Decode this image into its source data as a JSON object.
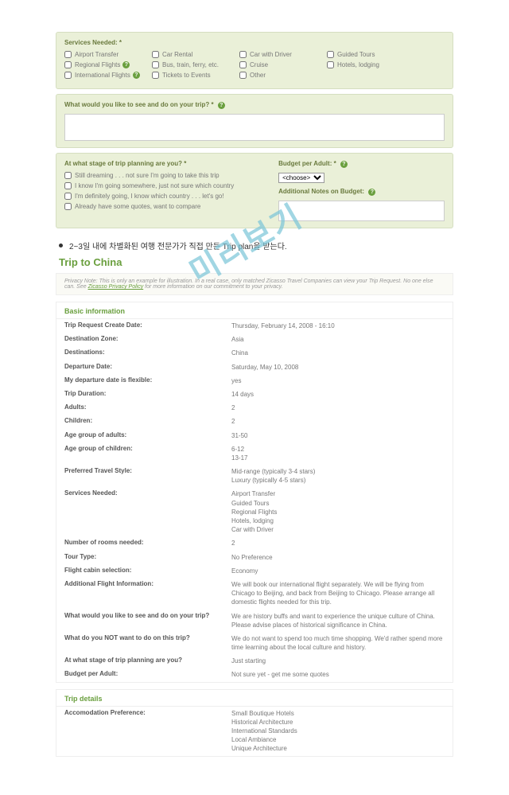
{
  "watermark": "미리보기",
  "services": {
    "label": "Services Needed: *",
    "items": [
      "Airport Transfer",
      "Car Rental",
      "Car with Driver",
      "Guided Tours",
      "Regional Flights",
      "Bus, train, ferry, etc.",
      "Cruise",
      "Hotels, lodging",
      "International Flights",
      "Tickets to Events",
      "Other"
    ]
  },
  "see_do": {
    "label": "What would you like to see and do on your trip? *"
  },
  "stage": {
    "label": "At what stage of trip planning are you? *",
    "options": [
      "Still dreaming . . . not sure I'm going to take this trip",
      "I know I'm going somewhere, just not sure which country",
      "I'm definitely going, I know which country . . . let's go!",
      "Already have some quotes, want to compare"
    ]
  },
  "budget": {
    "label": "Budget per Adult: *",
    "choose": "<choose>",
    "notes_label": "Additional Notes on Budget:"
  },
  "bullet": "2~3일 내에 차별화된 여행 전문가가 직접 만든 Trip plan을 받는다.",
  "page_title": "Trip to China",
  "notice": {
    "text": "Privacy Note: This is only an example for illustration. In a real case, only matched Zicasso Travel Companies can view your Trip Request. No one else can. See ",
    "link": "Zicasso Privacy Policy",
    "text2": " for more information on our commitment to your privacy."
  },
  "basic": {
    "head": "Basic information",
    "rows": [
      {
        "k": "Trip Request Create Date:",
        "v": "Thursday, February 14, 2008 - 16:10"
      },
      {
        "k": "Destination Zone:",
        "v": "Asia"
      },
      {
        "k": "Destinations:",
        "v": "China"
      },
      {
        "k": "Departure Date:",
        "v": "Saturday, May 10, 2008"
      },
      {
        "k": "My departure date is flexible:",
        "v": "yes"
      },
      {
        "k": "Trip Duration:",
        "v": "14 days"
      },
      {
        "k": "Adults:",
        "v": "2"
      },
      {
        "k": "Children:",
        "v": "2"
      },
      {
        "k": "Age group of adults:",
        "v": "31-50"
      },
      {
        "k": "Age group of children:",
        "v": "6-12\n13-17"
      },
      {
        "k": "Preferred Travel Style:",
        "v": "Mid-range (typically 3-4 stars)\nLuxury (typically 4-5 stars)"
      },
      {
        "k": "Services Needed:",
        "v": "Airport Transfer\nGuided Tours\nRegional Flights\nHotels, lodging\nCar with Driver"
      },
      {
        "k": "Number of rooms needed:",
        "v": "2"
      },
      {
        "k": "Tour Type:",
        "v": "No Preference"
      },
      {
        "k": "Flight cabin selection:",
        "v": "Economy"
      },
      {
        "k": "Additional Flight Information:",
        "v": "We will book our international flight separately. We will be flying from Chicago to Beijing, and back from Beijing to Chicago. Please arrange all domestic flights needed for this trip."
      },
      {
        "k": "What would you like to see and do on your trip?",
        "v": "We are history buffs and want to experience the unique culture of China. Please advise places of historical significance in China."
      },
      {
        "k": "What do you NOT want to do on this trip?",
        "v": "We do not want to spend too much time shopping. We'd rather spend more time learning about the local culture and history."
      },
      {
        "k": "At what stage of trip planning are you?",
        "v": "Just starting"
      },
      {
        "k": "Budget per Adult:",
        "v": "Not sure yet - get me some quotes"
      }
    ]
  },
  "details": {
    "head": "Trip details",
    "rows": [
      {
        "k": "Accomodation Preference:",
        "v": "Small Boutique Hotels\nHistorical Architecture\nInternational Standards\nLocal Ambiance\nUnique Architecture"
      }
    ]
  }
}
